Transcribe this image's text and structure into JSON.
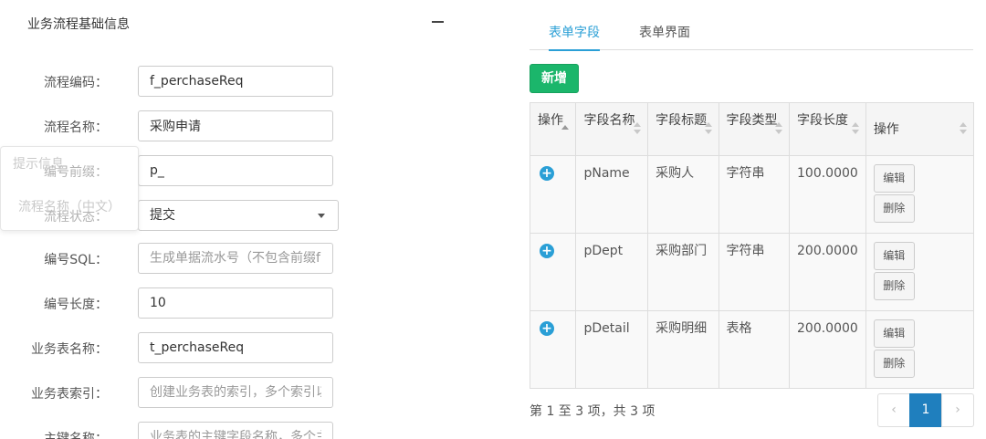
{
  "section": {
    "title": "业务流程基础信息"
  },
  "form": {
    "rows": [
      {
        "label": "流程编码：",
        "value": "f_perchaseReq",
        "placeholder": ""
      },
      {
        "label": "流程名称：",
        "value": "采购申请",
        "placeholder": ""
      },
      {
        "label": "编号前缀：",
        "value": "p_",
        "placeholder": ""
      },
      {
        "label": "流程状态：",
        "value": "提交"
      },
      {
        "label": "编号SQL：",
        "value": "",
        "placeholder": "生成单据流水号（不包含前缀f"
      },
      {
        "label": "编号长度：",
        "value": "10",
        "placeholder": ""
      },
      {
        "label": "业务表名称：",
        "value": "t_perchaseReq",
        "placeholder": ""
      },
      {
        "label": "业务表索引：",
        "value": "",
        "placeholder": "创建业务表的索引，多个索引以"
      },
      {
        "label": "主键名称：",
        "value": "",
        "placeholder": "业务表的主键字段名称，多个主"
      }
    ]
  },
  "tooltip": {
    "title": "提示信息",
    "body": "流程名称（中文）"
  },
  "tabs": [
    {
      "label": "表单字段",
      "active": true
    },
    {
      "label": "表单界面",
      "active": false
    }
  ],
  "toolbar": {
    "add_label": "新增"
  },
  "table": {
    "headers": [
      "操作",
      "字段名称",
      "字段标题",
      "字段类型",
      "字段长度",
      "操作"
    ],
    "rows": [
      {
        "name": "pName",
        "title": "采购人",
        "type": "字符串",
        "length": "100.0000"
      },
      {
        "name": "pDept",
        "title": "采购部门",
        "type": "字符串",
        "length": "200.0000"
      },
      {
        "name": "pDetail",
        "title": "采购明细",
        "type": "表格",
        "length": "200.0000"
      }
    ],
    "edit_label": "编辑",
    "delete_label": "删除",
    "expand_glyph": "+"
  },
  "pagination": {
    "info": "第 1 至 3 项，共 3 项",
    "prev": "‹",
    "current": "1",
    "next": "›"
  },
  "colors": {
    "accent": "#2a9fd6",
    "add_button": "#1bb66b",
    "page_active": "#1f7fbe"
  }
}
